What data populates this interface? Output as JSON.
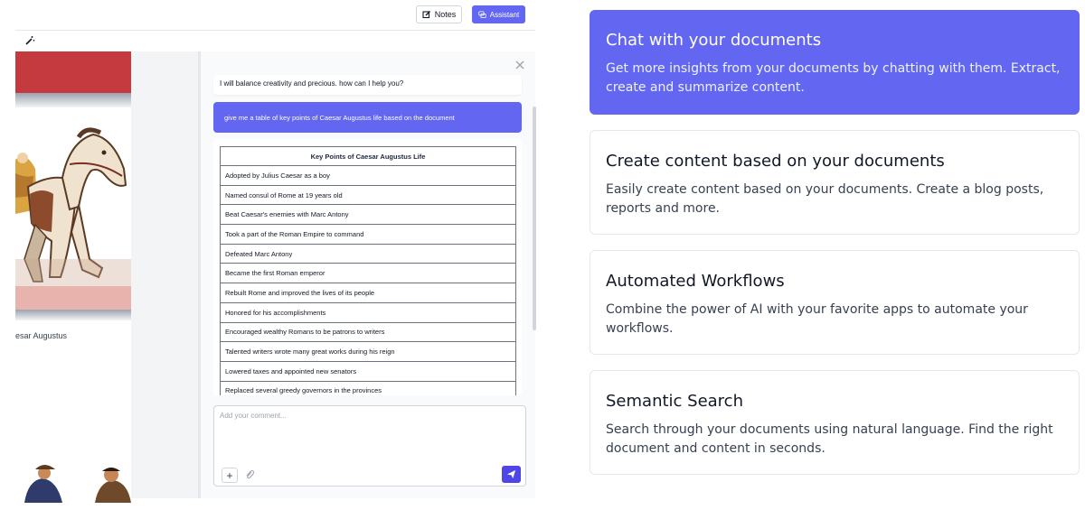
{
  "app": {
    "notes_label": "Notes",
    "assistant_label": "Assistant",
    "document": {
      "caption": "esar Augustus"
    },
    "chat": {
      "ai_greeting": "I will balance creativity and precious. how can I help you?",
      "user_message": "give me a table of key points of Caesar Augustus life based on the document",
      "table": {
        "header": "Key Points of Caesar Augustus Life",
        "rows": [
          "Adopted by Julius Caesar as a boy",
          "Named consul of Rome at 19 years old",
          "Beat Caesar's enemies with Marc Antony",
          "Took a part of the Roman Empire to command",
          "Defeated Marc Antony",
          "Became the first Roman emperor",
          "Rebuilt Rome and improved the lives of its people",
          "Honored for his accomplishments",
          "Encouraged wealthy Romans to be patrons to writers",
          "Talented writers wrote many great works during his reign",
          "Lowered taxes and appointed new senators",
          "Replaced several greedy governors in the provinces"
        ]
      },
      "comment_placeholder": "Add your comment...",
      "accent_color": "#6366f1"
    }
  },
  "features": [
    {
      "title": "Chat with your documents",
      "description": "Get more insights from your documents by chatting with them. Extract, create and summarize content.",
      "active": true
    },
    {
      "title": "Create content based on your documents",
      "description": "Easily create content based on your documents. Create a blog posts, reports and more.",
      "active": false
    },
    {
      "title": "Automated Workflows",
      "description": "Combine the power of AI with your favorite apps to automate your workflows.",
      "active": false
    },
    {
      "title": "Semantic Search",
      "description": "Search through your documents using natural language. Find the right document and content in seconds.",
      "active": false
    }
  ]
}
